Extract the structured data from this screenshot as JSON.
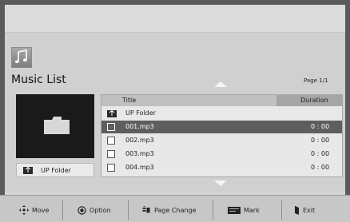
{
  "music_list": {
    "title": "Music List",
    "page_indicator": "Page 1/1"
  },
  "preview": {
    "up_folder_label": "UP Folder"
  },
  "list": {
    "headers": {
      "title": "Title",
      "duration": "Duration"
    },
    "rows": [
      {
        "type": "folder",
        "name": "UP Folder",
        "duration": ""
      },
      {
        "type": "file",
        "name": "001.mp3",
        "duration": "0 : 00",
        "selected": true
      },
      {
        "type": "file",
        "name": "002.mp3",
        "duration": "0 : 00"
      },
      {
        "type": "file",
        "name": "003.mp3",
        "duration": "0 : 00"
      },
      {
        "type": "file",
        "name": "004.mp3",
        "duration": "0 : 00"
      }
    ]
  },
  "bottom_hints": [
    {
      "icon": "move-icon",
      "label": "Move"
    },
    {
      "icon": "option-icon",
      "label": "Option"
    },
    {
      "icon": "page-change-icon",
      "label": "Page Change"
    },
    {
      "icon": "mark-icon",
      "label": "Mark"
    },
    {
      "icon": "exit-icon",
      "label": "Exit"
    }
  ],
  "colors": {
    "background": "#5b5b5b",
    "panel": "#d0d0d0",
    "selected_row": "#5e5e5e",
    "preview_bg": "#1a1a1a"
  }
}
